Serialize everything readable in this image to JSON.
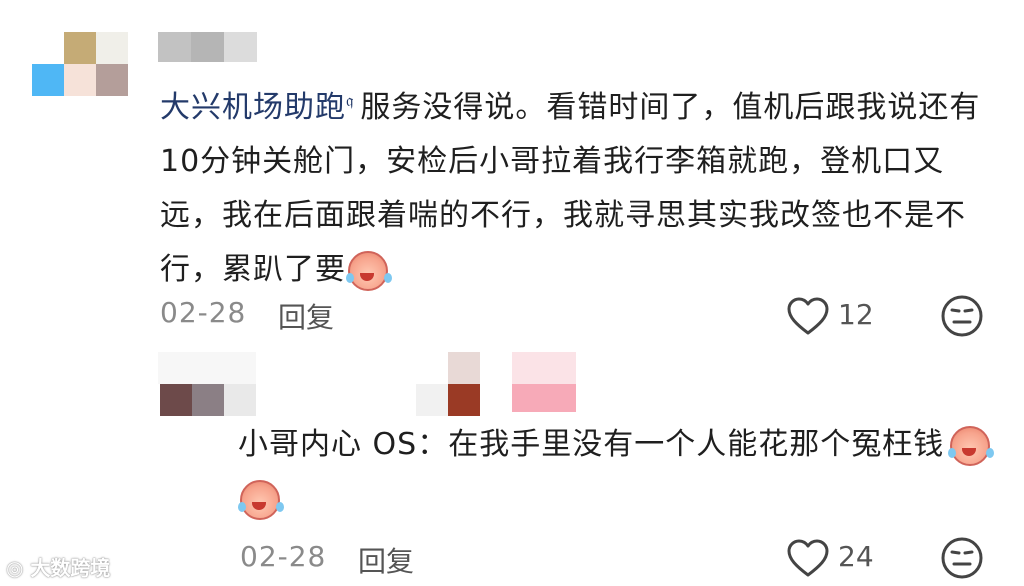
{
  "comment": {
    "mention": "大兴机场助跑",
    "body": "服务没得说。看错时间了，值机后跟我说还有10分钟关舱门，安检后小哥拉着我行李箱就跑，登机口又远，我在后面跟着喘的不行，我就寻思其实我改签也不是不行，累趴了要",
    "date": "02-28",
    "reply_label": "回复",
    "likes": "12",
    "emoji": "cry-laugh-icon"
  },
  "reply": {
    "body": "小哥内心 OS：在我手里没有一个人能花那个冤枉钱",
    "date": "02-28",
    "reply_label": "回复",
    "likes": "24"
  },
  "watermark": "大数跨境",
  "colors": {
    "mention": "#233a6a",
    "text": "#1f1f1f",
    "meta": "#8a8a8a"
  }
}
